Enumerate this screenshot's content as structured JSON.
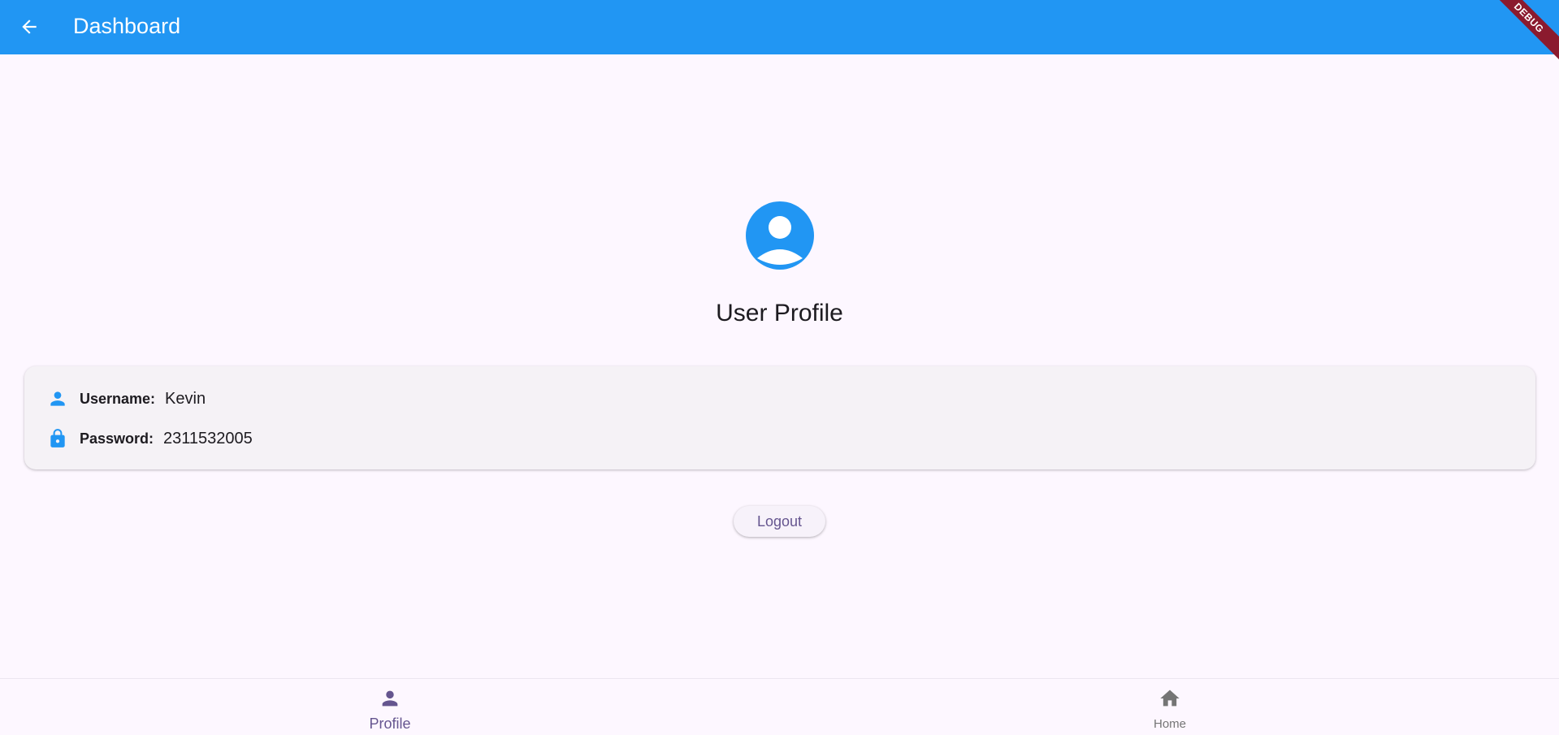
{
  "appbar": {
    "title": "Dashboard",
    "back_icon": "arrow-back-icon",
    "debug_banner": "DEBUG",
    "color": "#2196f3"
  },
  "profile": {
    "avatar_icon": "account-circle-icon",
    "title": "User Profile"
  },
  "card": {
    "username_label": "Username:",
    "username_value": "Kevin",
    "username_icon": "person-icon",
    "password_label": "Password:",
    "password_value": "2311532005",
    "password_icon": "lock-icon"
  },
  "logout_button": {
    "label": "Logout"
  },
  "bottom_nav": {
    "items": [
      {
        "label": "Profile",
        "icon": "person-icon",
        "selected": true
      },
      {
        "label": "Home",
        "icon": "home-icon",
        "selected": false
      }
    ]
  },
  "colors": {
    "accent": "#2196f3",
    "primary": "#65558f",
    "background": "#fdf7ff",
    "card": "#f5f2f6"
  }
}
